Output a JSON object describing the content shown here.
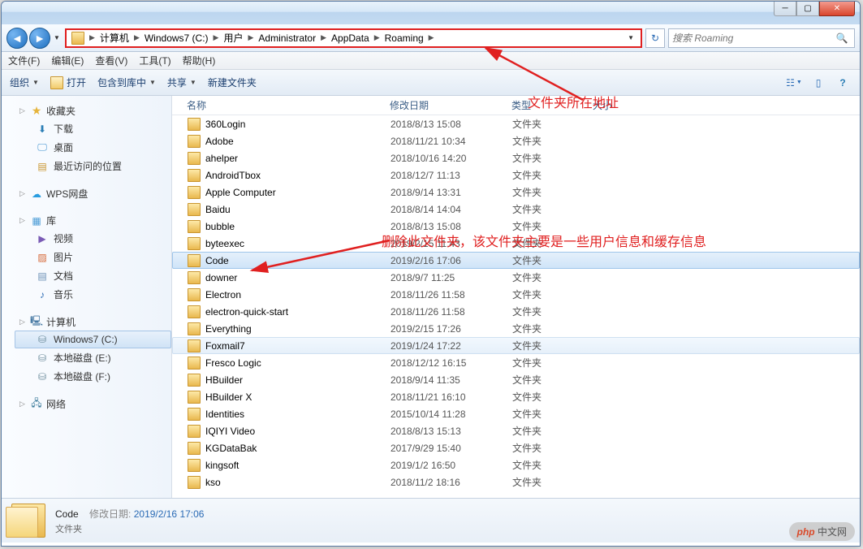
{
  "breadcrumbs": [
    "计算机",
    "Windows7 (C:)",
    "用户",
    "Administrator",
    "AppData",
    "Roaming"
  ],
  "search": {
    "placeholder": "搜索 Roaming"
  },
  "menu": {
    "file": "文件(F)",
    "edit": "编辑(E)",
    "view": "查看(V)",
    "tools": "工具(T)",
    "help": "帮助(H)"
  },
  "toolbar": {
    "organize": "组织",
    "open": "打开",
    "include": "包含到库中",
    "share": "共享",
    "new_folder": "新建文件夹"
  },
  "columns": {
    "name": "名称",
    "date": "修改日期",
    "type": "类型",
    "size": "大小"
  },
  "sidebar": {
    "favorites": {
      "label": "收藏夹",
      "downloads": "下载",
      "desktop": "桌面",
      "recent": "最近访问的位置"
    },
    "wps": "WPS网盘",
    "libraries": {
      "label": "库",
      "videos": "视频",
      "pictures": "图片",
      "documents": "文档",
      "music": "音乐"
    },
    "computer": {
      "label": "计算机",
      "c": "Windows7 (C:)",
      "e": "本地磁盘 (E:)",
      "f": "本地磁盘 (F:)"
    },
    "network": "网络"
  },
  "files": [
    {
      "name": "360Login",
      "date": "2018/8/13 15:08",
      "type": "文件夹"
    },
    {
      "name": "Adobe",
      "date": "2018/11/21 10:34",
      "type": "文件夹"
    },
    {
      "name": "ahelper",
      "date": "2018/10/16 14:20",
      "type": "文件夹"
    },
    {
      "name": "AndroidTbox",
      "date": "2018/12/7 11:13",
      "type": "文件夹"
    },
    {
      "name": "Apple Computer",
      "date": "2018/9/14 13:31",
      "type": "文件夹"
    },
    {
      "name": "Baidu",
      "date": "2018/8/14 14:04",
      "type": "文件夹"
    },
    {
      "name": "bubble",
      "date": "2018/8/13 15:08",
      "type": "文件夹"
    },
    {
      "name": "byteexec",
      "date": "2019/2/15 11:43",
      "type": "文件夹"
    },
    {
      "name": "Code",
      "date": "2019/2/16 17:06",
      "type": "文件夹",
      "selected": true
    },
    {
      "name": "downer",
      "date": "2018/9/7 11:25",
      "type": "文件夹"
    },
    {
      "name": "Electron",
      "date": "2018/11/26 11:58",
      "type": "文件夹"
    },
    {
      "name": "electron-quick-start",
      "date": "2018/11/26 11:58",
      "type": "文件夹"
    },
    {
      "name": "Everything",
      "date": "2019/2/15 17:26",
      "type": "文件夹"
    },
    {
      "name": "Foxmail7",
      "date": "2019/1/24 17:22",
      "type": "文件夹",
      "hover": true
    },
    {
      "name": "Fresco Logic",
      "date": "2018/12/12 16:15",
      "type": "文件夹"
    },
    {
      "name": "HBuilder",
      "date": "2018/9/14 11:35",
      "type": "文件夹"
    },
    {
      "name": "HBuilder X",
      "date": "2018/11/21 16:10",
      "type": "文件夹"
    },
    {
      "name": "Identities",
      "date": "2015/10/14 11:28",
      "type": "文件夹"
    },
    {
      "name": "IQIYI Video",
      "date": "2018/8/13 15:13",
      "type": "文件夹"
    },
    {
      "name": "KGDataBak",
      "date": "2017/9/29 15:40",
      "type": "文件夹"
    },
    {
      "name": "kingsoft",
      "date": "2019/1/2 16:50",
      "type": "文件夹"
    },
    {
      "name": "kso",
      "date": "2018/11/2 18:16",
      "type": "文件夹"
    }
  ],
  "status": {
    "name": "Code",
    "date_label": "修改日期:",
    "date_value": "2019/2/16 17:06",
    "type": "文件夹"
  },
  "annotations": {
    "a1": "文件夹所在地址",
    "a2": "删除此文件夹，该文件夹主要是一些用户信息和缓存信息"
  },
  "watermark": {
    "brand": "php",
    "text": "中文网"
  }
}
